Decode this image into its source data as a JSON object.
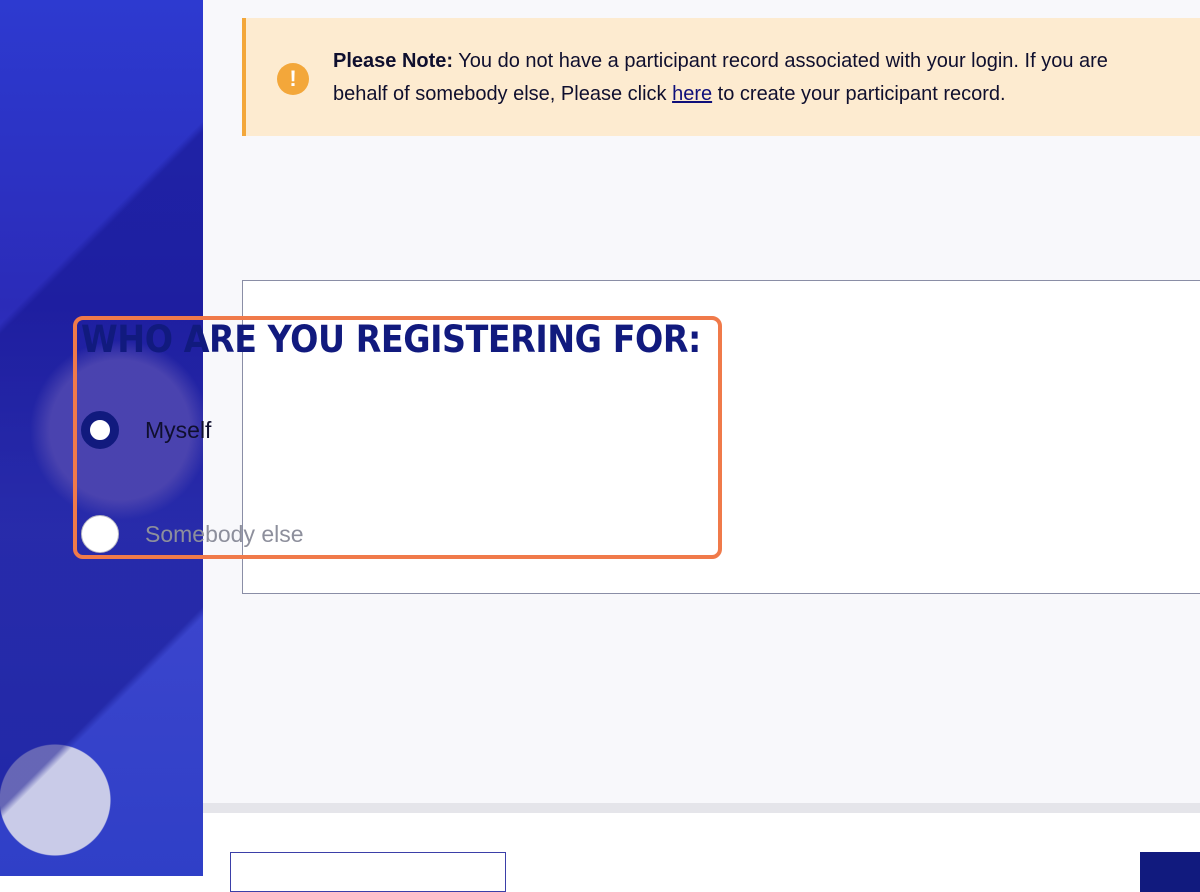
{
  "notice": {
    "icon": "exclamation-icon",
    "icon_glyph": "!",
    "bold": "Please Note:",
    "text_before_link": " You do not have a participant record associated with your login. If you are",
    "text_line2_before_link": "behalf of somebody else, Please click ",
    "link": "here",
    "text_after_link": " to create your participant record.",
    "accent_color": "#f3a73a",
    "background_color": "#fdebd0"
  },
  "form": {
    "heading": "WHO ARE YOU REGISTERING FOR:",
    "options": [
      {
        "label": "Myself",
        "selected": true
      },
      {
        "label": "Somebody else",
        "selected": false
      }
    ],
    "accent_color": "#111a7e",
    "highlight_color": "#f07a4a"
  }
}
